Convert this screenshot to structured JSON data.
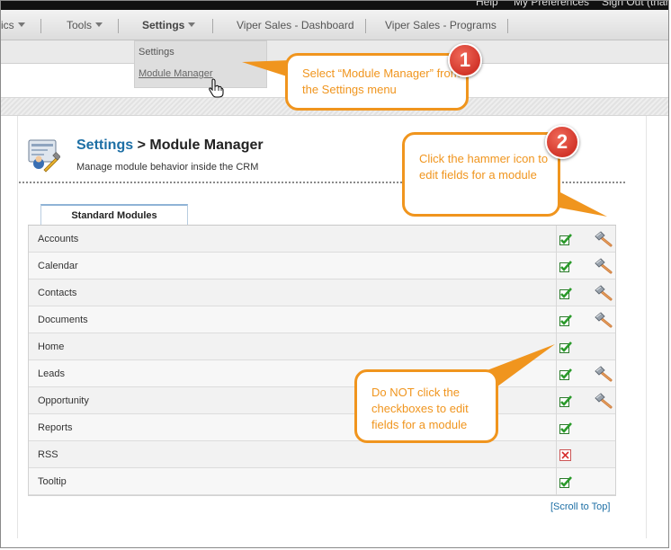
{
  "top_links": {
    "help": "Help",
    "preferences": "My Preferences",
    "signout": "Sign Out (thar"
  },
  "nav": {
    "items": [
      {
        "label": "ics",
        "has_caret": true
      },
      {
        "label": "Tools",
        "has_caret": true
      },
      {
        "label": "Settings",
        "has_caret": true
      },
      {
        "label": "Viper Sales - Dashboard",
        "has_caret": false
      },
      {
        "label": "Viper Sales - Programs",
        "has_caret": false
      }
    ]
  },
  "dropdown": {
    "items": [
      "Settings",
      "Module Manager"
    ],
    "selected": "Module Manager"
  },
  "page": {
    "breadcrumb_link": "Settings",
    "breadcrumb_sep": " > ",
    "title": "Module Manager",
    "subtitle": "Manage module behavior inside the CRM"
  },
  "tab": {
    "label": "Standard Modules"
  },
  "modules": [
    {
      "name": "Accounts",
      "enabled": true,
      "editable": true
    },
    {
      "name": "Calendar",
      "enabled": true,
      "editable": true
    },
    {
      "name": "Contacts",
      "enabled": true,
      "editable": true
    },
    {
      "name": "Documents",
      "enabled": true,
      "editable": true
    },
    {
      "name": "Home",
      "enabled": true,
      "editable": false
    },
    {
      "name": "Leads",
      "enabled": true,
      "editable": true
    },
    {
      "name": "Opportunity",
      "enabled": true,
      "editable": true
    },
    {
      "name": "Reports",
      "enabled": true,
      "editable": false
    },
    {
      "name": "RSS",
      "enabled": false,
      "editable": false
    },
    {
      "name": "Tooltip",
      "enabled": true,
      "editable": false
    }
  ],
  "scroll_top": "[Scroll to Top]",
  "callouts": [
    {
      "number": "1",
      "text": "Select “Module Manager” from the Settings menu"
    },
    {
      "number": "2",
      "text": "Click the hammer icon to edit fields for a module"
    },
    {
      "number": "",
      "text": "Do NOT click the checkboxes to edit fields for a module"
    }
  ],
  "colors": {
    "callout": "#f0951e",
    "badge": "#d2352a",
    "link": "#1d6fa5",
    "check_green": "#2a9a2a",
    "check_red": "#d62c2c"
  }
}
